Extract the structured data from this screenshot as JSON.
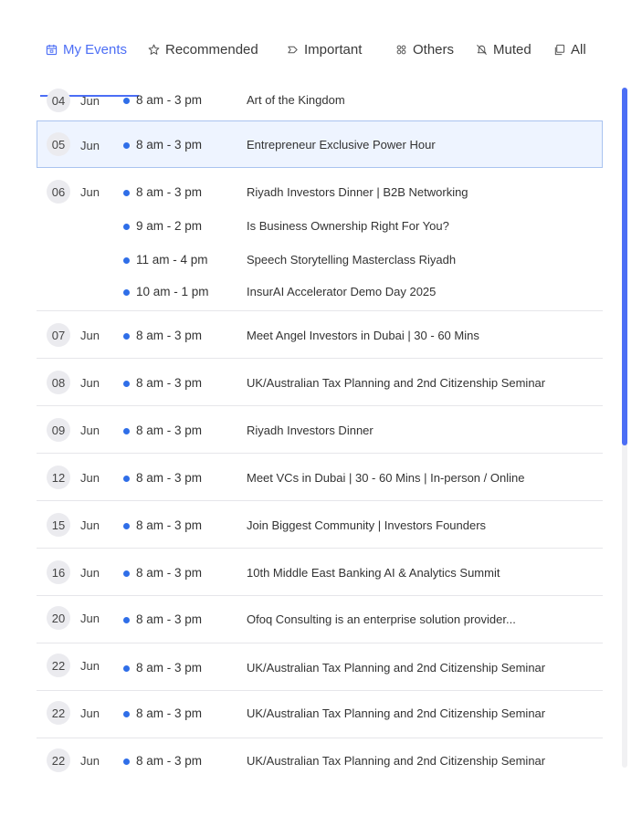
{
  "tabs": [
    {
      "label": "My Events",
      "icon": "calendar-icon"
    },
    {
      "label": "Recommended",
      "icon": "star-icon"
    },
    {
      "label": "Important",
      "icon": "label-icon"
    },
    {
      "label": "Others",
      "icon": "dots-icon"
    },
    {
      "label": "Muted",
      "icon": "mute-icon"
    },
    {
      "label": "All",
      "icon": "copy-icon"
    }
  ],
  "active_tab": "My Events",
  "accent_color": "#4c6ef5",
  "dot_color": "#2f6ee8",
  "days": [
    {
      "day": "04",
      "month": "Jun",
      "events": [
        {
          "time": "8 am - 3 pm",
          "title": "Art of the Kingdom"
        }
      ]
    },
    {
      "day": "05",
      "month": "Jun",
      "selected": true,
      "events": [
        {
          "time": "8 am - 3 pm",
          "title": "Entrepreneur Exclusive Power Hour"
        }
      ]
    },
    {
      "day": "06",
      "month": "Jun",
      "events": [
        {
          "time": "8 am - 3 pm",
          "title": "Riyadh Investors Dinner | B2B Networking"
        },
        {
          "time": "9 am - 2 pm",
          "title": "Is Business Ownership Right For You?"
        },
        {
          "time": "11 am - 4 pm",
          "title": "Speech Storytelling Masterclass Riyadh"
        },
        {
          "time": "10 am - 1 pm",
          "title": "InsurAI Accelerator Demo Day 2025"
        }
      ]
    },
    {
      "day": "07",
      "month": "Jun",
      "events": [
        {
          "time": "8 am - 3 pm",
          "title": "Meet Angel Investors in Dubai | 30 - 60 Mins"
        }
      ]
    },
    {
      "day": "08",
      "month": "Jun",
      "events": [
        {
          "time": "8 am - 3 pm",
          "title": "UK/Australian Tax Planning and 2nd Citizenship Seminar"
        }
      ]
    },
    {
      "day": "09",
      "month": "Jun",
      "events": [
        {
          "time": "8 am - 3 pm",
          "title": "Riyadh Investors Dinner"
        }
      ]
    },
    {
      "day": "12",
      "month": "Jun",
      "events": [
        {
          "time": "8 am - 3 pm",
          "title": "Meet VCs in Dubai | 30 - 60 Mins | In-person / Online"
        }
      ]
    },
    {
      "day": "15",
      "month": "Jun",
      "events": [
        {
          "time": "8 am - 3 pm",
          "title": "Join Biggest Community | Investors Founders"
        }
      ]
    },
    {
      "day": "16",
      "month": "Jun",
      "events": [
        {
          "time": "8 am - 3 pm",
          "title": "10th Middle East Banking AI & Analytics Summit"
        }
      ]
    },
    {
      "day": "20",
      "month": "Jun",
      "events": [
        {
          "time": "8 am - 3 pm",
          "title": "Ofoq Consulting is an enterprise solution provider..."
        }
      ]
    },
    {
      "day": "22",
      "month": "Jun",
      "events": [
        {
          "time": "8 am - 3 pm",
          "title": "UK/Australian Tax Planning and 2nd Citizenship Seminar"
        }
      ]
    },
    {
      "day": "22",
      "month": "Jun",
      "events": [
        {
          "time": "8 am - 3 pm",
          "title": "UK/Australian Tax Planning and 2nd Citizenship Seminar"
        }
      ]
    },
    {
      "day": "22",
      "month": "Jun",
      "events": [
        {
          "time": "8 am - 3 pm",
          "title": "UK/Australian Tax Planning and 2nd Citizenship Seminar"
        }
      ]
    }
  ]
}
